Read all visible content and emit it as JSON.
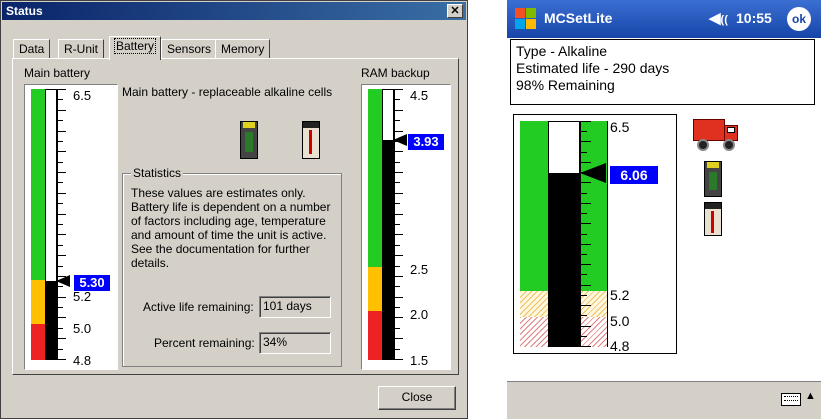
{
  "dialog": {
    "title": "Status",
    "tabs": [
      "Data",
      "R-Unit",
      "Battery",
      "Sensors",
      "Memory"
    ],
    "active_tab": "Battery",
    "main_battery_label": "Main battery",
    "main_battery_desc": "Main battery - replaceable alkaline cells",
    "main_scale": {
      "top": "6.5",
      "mid1": "5.2",
      "mid2": "5.0",
      "bottom": "4.8",
      "current": "5.30"
    },
    "statistics": {
      "legend": "Statistics",
      "text": "These values are estimates only. Battery life is dependent on a number of factors including age, temperature and amount of time the unit is active. See the documentation for further details.",
      "active_life_label": "Active life remaining:",
      "active_life_value": "101 days",
      "percent_label": "Percent remaining:",
      "percent_value": "34%"
    },
    "ram_label": "RAM backup",
    "ram_scale": {
      "top": "4.5",
      "mid1": "2.5",
      "mid2": "2.0",
      "bottom": "1.5",
      "current": "3.93"
    },
    "close_label": "Close",
    "levels": {
      "main_fraction": 0.29,
      "ram_fraction": 0.81
    }
  },
  "ppc": {
    "app_title": "MCSetLite",
    "time": "10:55",
    "ok_label": "ok",
    "info": [
      "Type - Alkaline",
      "Estimated life - 290 days",
      "98% Remaining"
    ],
    "scale": {
      "top": "6.5",
      "mid1": "5.2",
      "mid2": "5.0",
      "bottom": "4.8",
      "current": "6.06"
    },
    "level_fraction": 0.77
  },
  "colors": {
    "green": "#22cc22",
    "yellow": "#ffc000",
    "red": "#ee2222",
    "pointer_blue": "#0000ff"
  }
}
